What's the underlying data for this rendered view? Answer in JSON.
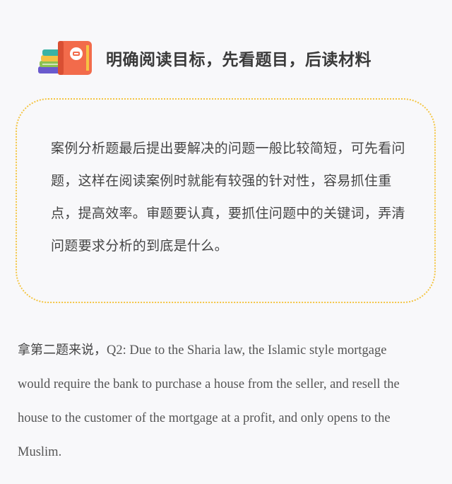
{
  "header": {
    "icon": "books-icon",
    "title": "明确阅读目标，先看题目，后读材料"
  },
  "tip_box": {
    "text": "案例分析题最后提出要解决的问题一般比较简短，可先看问题，这样在阅读案例时就能有较强的针对性，容易抓住重点，提高效率。审题要认真，要抓住问题中的关键词，弄清问题要求分析的到底是什么。"
  },
  "body": {
    "lead": "拿第二题来说，",
    "text": "Q2: Due to the Sharia law, the Islamic style mortgage would require the bank to purchase a house from the seller, and resell the house to the customer of the mortgage at a profit, and only opens to the Muslim."
  },
  "colors": {
    "border": "#f4c542",
    "book_red": "#f26b4b",
    "book_green": "#8cc152",
    "book_purple": "#6a5acd",
    "book_yellow": "#f6c244",
    "book_teal": "#3bb3a5"
  }
}
